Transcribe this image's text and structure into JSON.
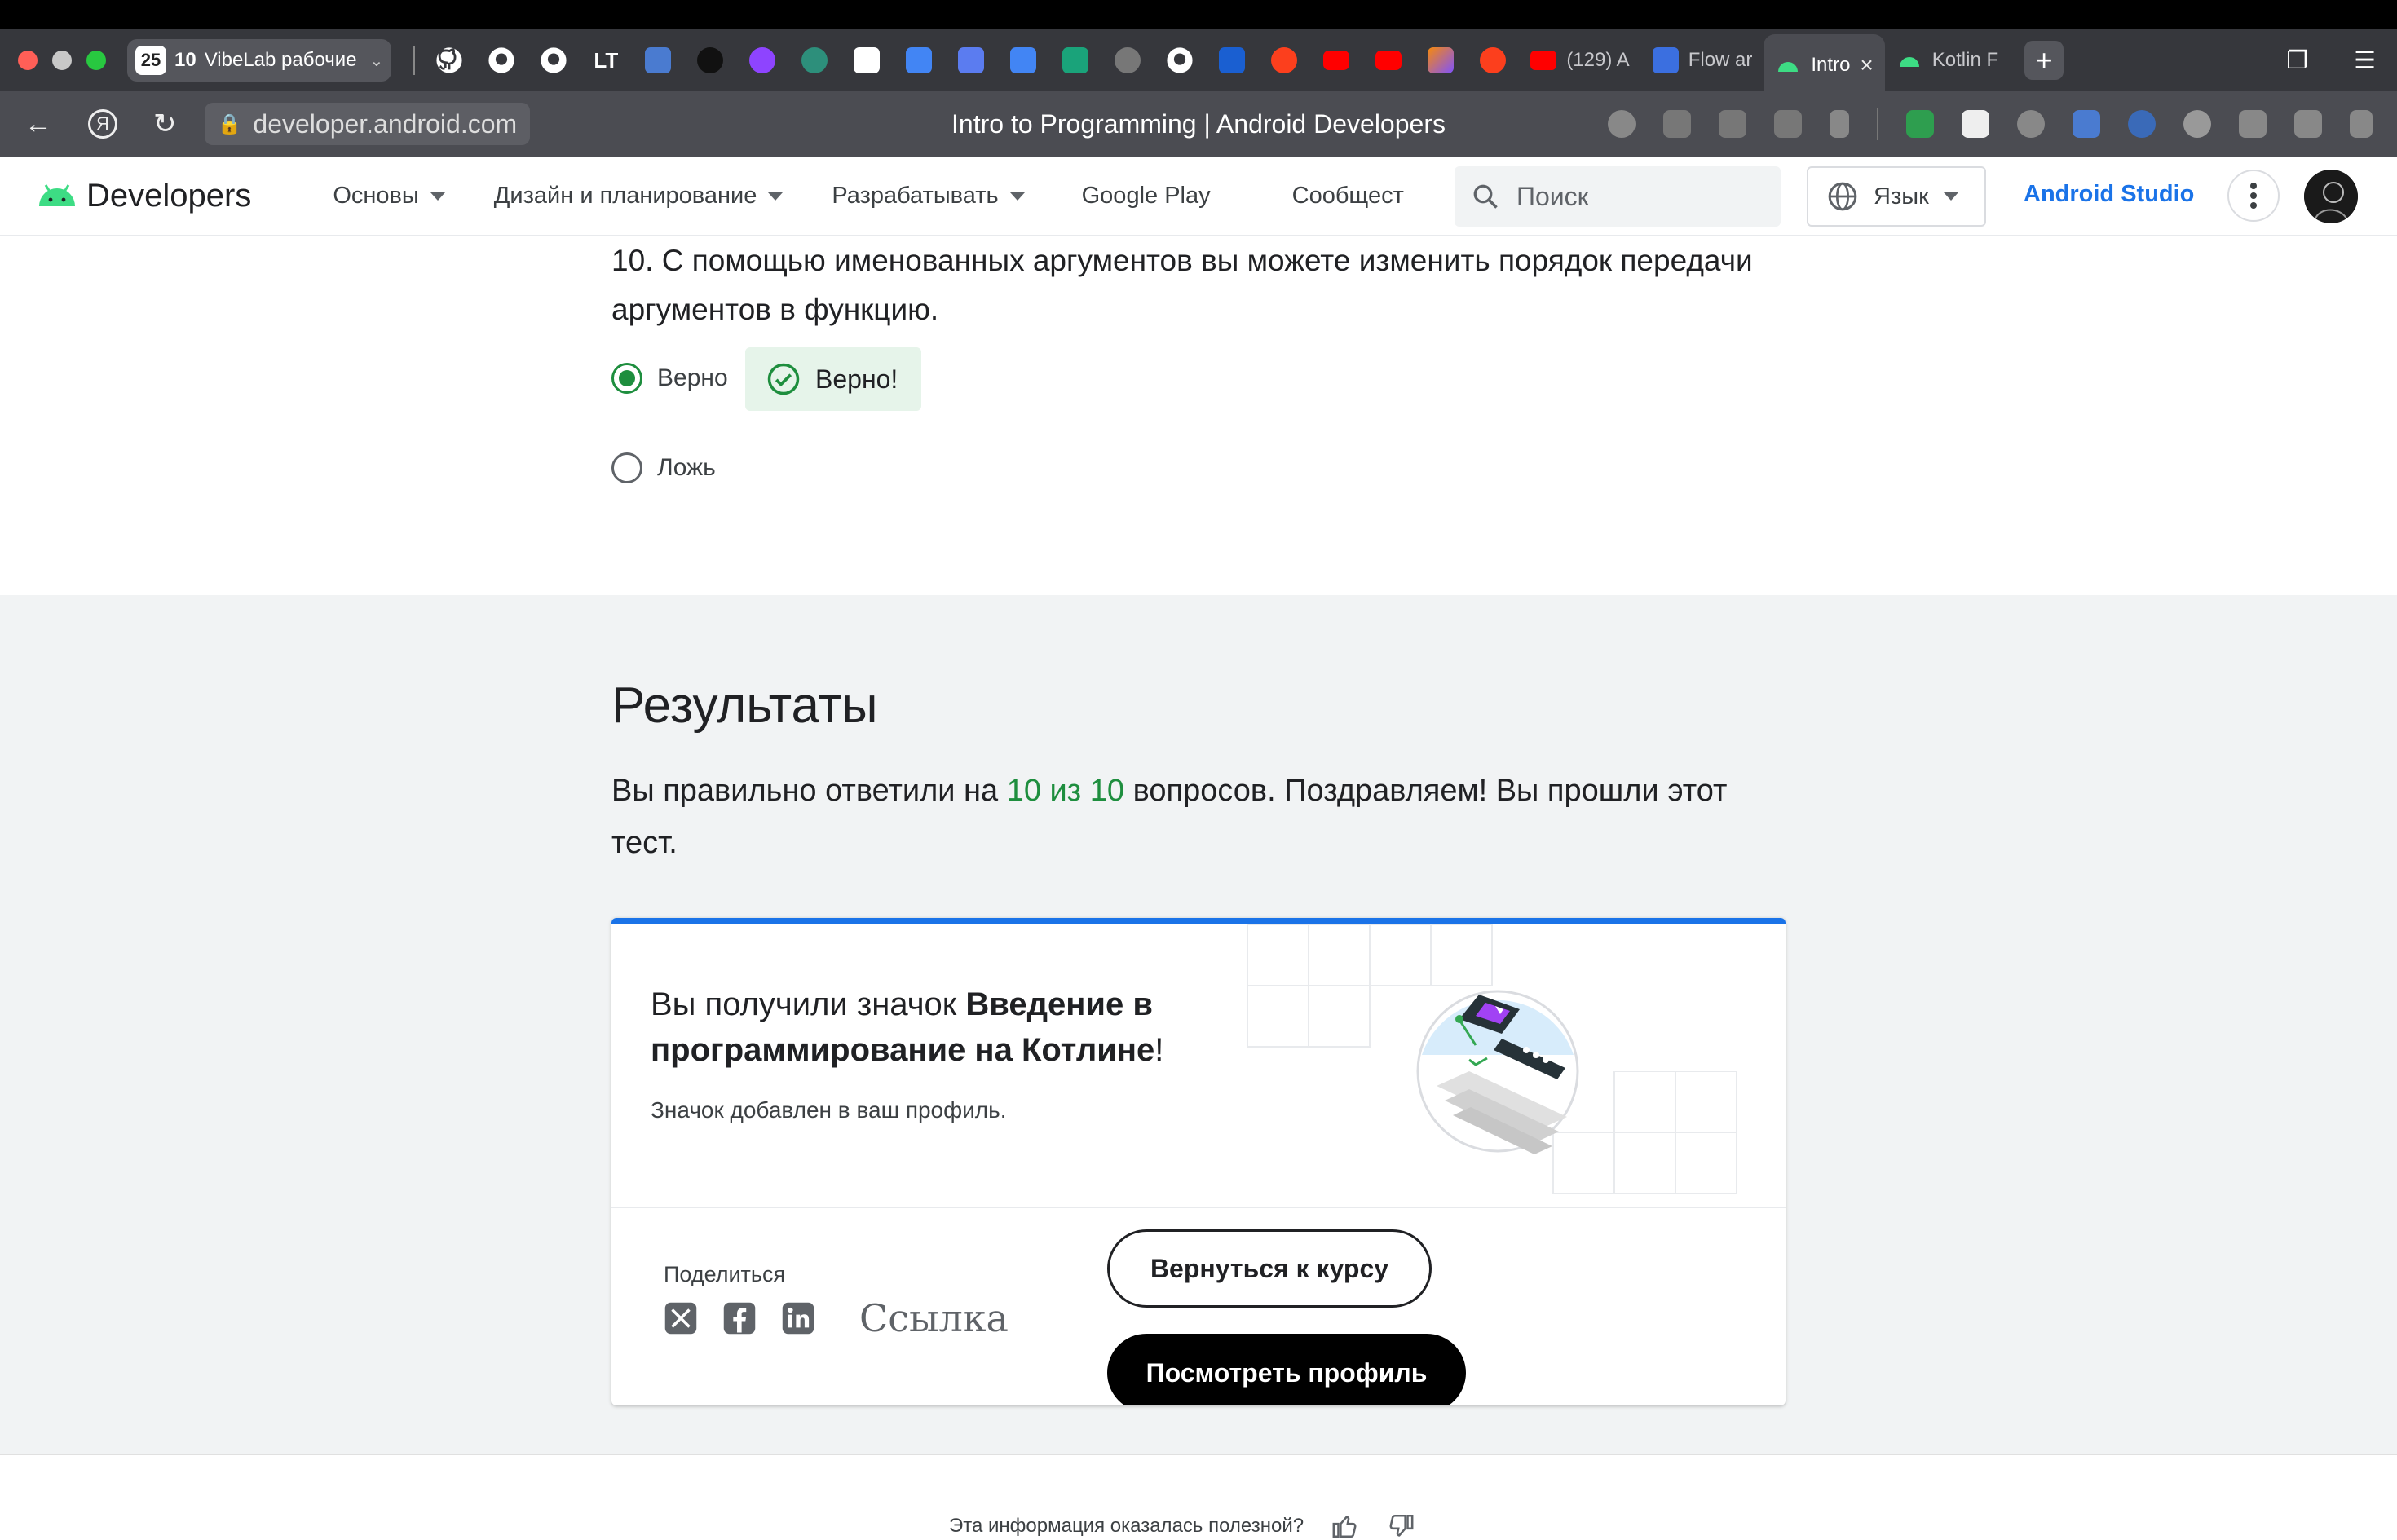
{
  "browser": {
    "tab_group": {
      "count": "25",
      "tab_count": "10",
      "name": "VibeLab рабочие"
    },
    "tabs": [
      {
        "label": "(129) A"
      },
      {
        "label": "Flow ar"
      },
      {
        "label": "Intro"
      },
      {
        "label": "Kotlin F"
      }
    ],
    "address": {
      "domain": "developer.android.com",
      "page_title": "Intro to Programming  |  Android Developers"
    }
  },
  "site": {
    "logo_text": "Developers",
    "nav": [
      {
        "label": "Основы"
      },
      {
        "label": "Дизайн и планирование"
      },
      {
        "label": "Разрабатывать"
      },
      {
        "label": "Google Play"
      },
      {
        "label": "Сообщест"
      }
    ],
    "search_placeholder": "Поиск",
    "language_label": "Язык",
    "android_studio_label": "Android Studio"
  },
  "question": {
    "text": "10. С помощью именованных аргументов вы можете изменить порядок передачи аргументов в функцию.",
    "options": [
      {
        "label": "Верно",
        "selected": true
      },
      {
        "label": "Ложь",
        "selected": false
      }
    ],
    "feedback": "Верно!"
  },
  "results": {
    "title": "Результаты",
    "text_before": "Вы правильно ответили на ",
    "score": "10 из 10",
    "text_after": " вопросов. Поздравляем! Вы прошли этот тест."
  },
  "badge_card": {
    "earned_prefix": "Вы получили значок ",
    "badge_name": "Введение в программирование на Котлине",
    "earned_suffix": "!",
    "added_text": "Значок добавлен в ваш профиль.",
    "share_label": "Поделиться",
    "link_label": "Ссылка",
    "return_button": "Вернуться к курсу",
    "profile_button": "Посмотреть профиль"
  },
  "footer": {
    "helpful_question": "Эта информация оказалась полезной?"
  },
  "colors": {
    "accent_blue": "#1a73e8",
    "success_green": "#1e8e3e",
    "android_green": "#3ddc84"
  }
}
